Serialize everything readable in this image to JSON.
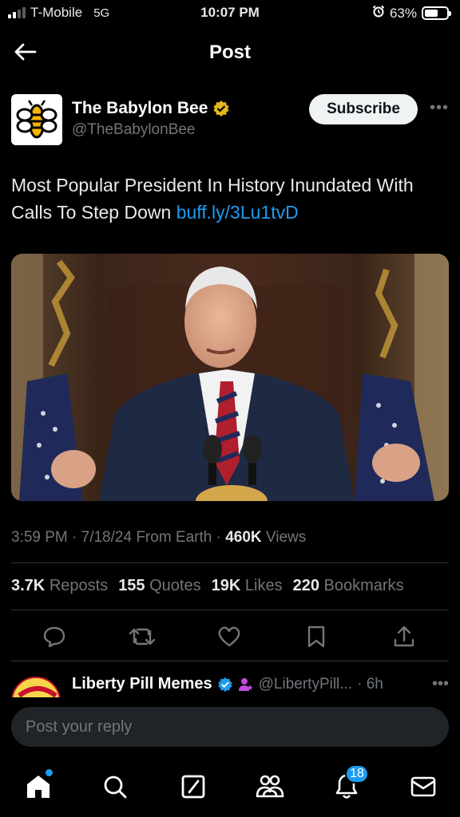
{
  "status_bar": {
    "carrier": "T-Mobile",
    "network": "5G",
    "time": "10:07 PM",
    "battery": "63%",
    "battery_level": 0.63
  },
  "header": {
    "title": "Post",
    "back_icon": "arrow-left-icon"
  },
  "post": {
    "author_name": "The Babylon Bee",
    "author_handle": "@TheBabylonBee",
    "verified_color": "#e2b719",
    "subscribe_label": "Subscribe",
    "more_label": "•••",
    "text": "Most Popular President In History Inundated With Calls To Step Down ",
    "link": "buff.ly/3Lu1tvD",
    "meta_time": "3:59 PM · 7/18/24 From Earth · ",
    "views_count": "460K",
    "views_label": " Views",
    "stats": {
      "reposts_count": "3.7K",
      "reposts_label": "Reposts",
      "quotes_count": "155",
      "quotes_label": "Quotes",
      "likes_count": "19K",
      "likes_label": "Likes",
      "bookmarks_count": "220",
      "bookmarks_label": "Bookmarks"
    },
    "actions": [
      "reply-icon",
      "repost-icon",
      "like-icon",
      "bookmark-icon",
      "share-icon"
    ]
  },
  "reply_preview": {
    "name": "Liberty Pill Memes",
    "handle": "@LibertyPill...",
    "time": "· 6h",
    "more_label": "•••"
  },
  "reply_input": {
    "placeholder": "Post your reply"
  },
  "tab_bar": {
    "items": [
      "home-icon",
      "search-icon",
      "grok-icon",
      "communities-icon",
      "notifications-icon",
      "messages-icon"
    ],
    "notifications_count": "18"
  },
  "colors": {
    "accent": "#1d9bf0",
    "background": "#000000",
    "text": "#e7e9ea",
    "secondary_text": "#71767b"
  }
}
